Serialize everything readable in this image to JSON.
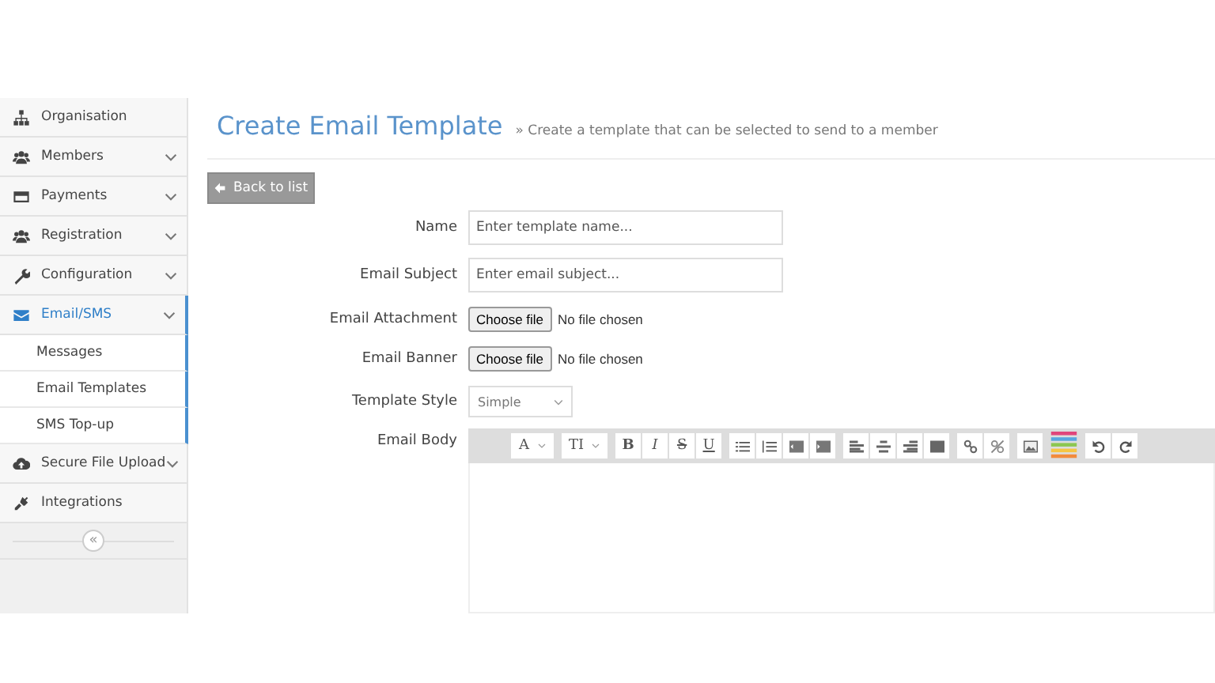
{
  "sidebar": {
    "items": [
      {
        "label": "Organisation",
        "expandable": false,
        "selected": false,
        "expanded": false
      },
      {
        "label": "Members",
        "expandable": true,
        "selected": false,
        "expanded": false
      },
      {
        "label": "Payments",
        "expandable": true,
        "selected": false,
        "expanded": false
      },
      {
        "label": "Registration",
        "expandable": true,
        "selected": false,
        "expanded": false
      },
      {
        "label": "Configuration",
        "expandable": true,
        "selected": false,
        "expanded": false
      },
      {
        "label": "Email/SMS",
        "expandable": true,
        "selected": true,
        "expanded": true,
        "children": [
          {
            "label": "Messages"
          },
          {
            "label": "Email Templates"
          },
          {
            "label": "SMS Top-up"
          }
        ]
      },
      {
        "label": "Secure File Upload",
        "expandable": true,
        "selected": false,
        "expanded": false
      },
      {
        "label": "Integrations",
        "expandable": false,
        "selected": false,
        "expanded": false
      }
    ],
    "collapse_button": "«"
  },
  "header": {
    "title": "Create Email Template",
    "subtitle": "» Create a template that can be selected to send to a member"
  },
  "back_button": "Back to list",
  "form": {
    "name": {
      "label": "Name",
      "placeholder": "Enter template name..."
    },
    "subject": {
      "label": "Email Subject",
      "placeholder": "Enter email subject..."
    },
    "files": [
      {
        "label": "Email Attachment",
        "button": "Choose file",
        "status": "No file chosen"
      },
      {
        "label": "Email Banner",
        "button": "Choose file",
        "status": "No file chosen"
      }
    ],
    "style": {
      "label": "Template Style",
      "value": "Simple"
    },
    "body": {
      "label": "Email Body",
      "toolbar": {
        "font_button": "A",
        "size_button": "TI",
        "format_buttons": [
          "B",
          "I",
          "S",
          "U"
        ]
      }
    }
  }
}
